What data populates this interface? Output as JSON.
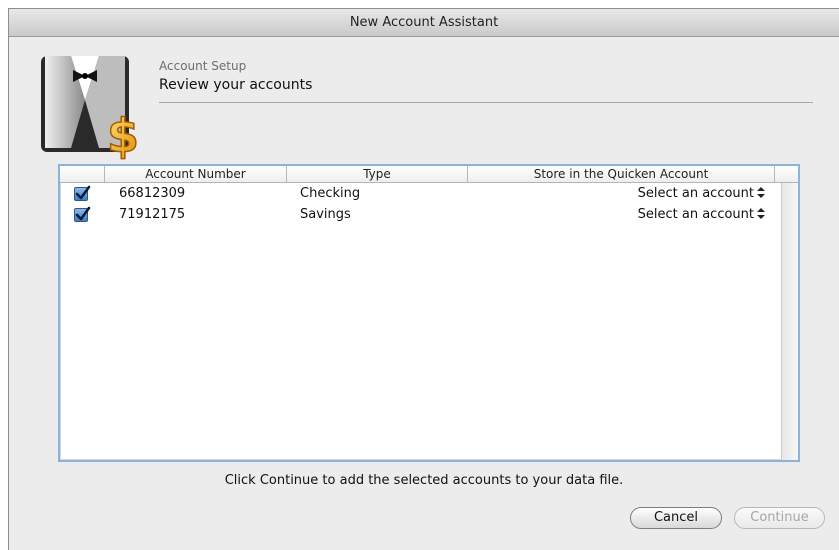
{
  "window": {
    "title": "New Account Assistant"
  },
  "header": {
    "subtitle": "Account Setup",
    "heading": "Review your accounts"
  },
  "table": {
    "columns": [
      "",
      "Account Number",
      "Type",
      "Store in the Quicken Account"
    ],
    "rows": [
      {
        "checked": true,
        "account_number": "66812309",
        "type": "Checking",
        "store": "Select an account"
      },
      {
        "checked": true,
        "account_number": "71912175",
        "type": "Savings",
        "store": "Select an account"
      }
    ]
  },
  "footer": {
    "instruction": "Click Continue to add the selected accounts to your data file.",
    "cancel_label": "Cancel",
    "continue_label": "Continue"
  },
  "icons": {
    "logo": "quicken-tuxedo-dollar-logo",
    "checkbox": "checkmark-icon",
    "select": "up-down-arrows-icon"
  },
  "colors": {
    "accent": "#3b7fd4",
    "table_border": "#8fb2d8",
    "disabled_text": "#a6a6a6"
  }
}
